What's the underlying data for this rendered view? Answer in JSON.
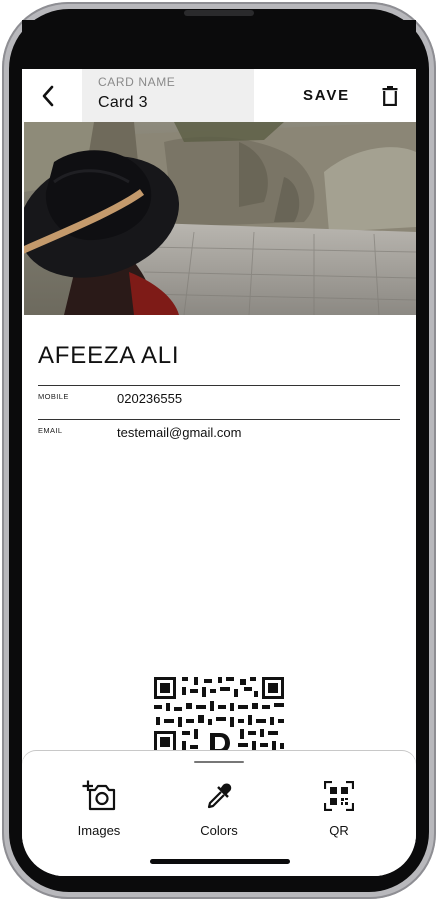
{
  "header": {
    "card_name_label": "CARD NAME",
    "card_name_value": "Card 3",
    "save_label": "SAVE"
  },
  "contact": {
    "name": "AFEEZA ALI",
    "fields": [
      {
        "label": "MOBILE",
        "value": "020236555"
      },
      {
        "label": "EMAIL",
        "value": "testemail@gmail.com"
      }
    ]
  },
  "toolbar": {
    "images_label": "Images",
    "colors_label": "Colors",
    "qr_label": "QR"
  },
  "icons": {
    "back": "chevron-left-icon",
    "delete": "trash-icon",
    "images": "camera-add-icon",
    "colors": "eyedropper-icon",
    "qr": "qr-scan-icon"
  },
  "colors": {
    "screen_bg": "#ffffff",
    "text": "#111111",
    "card_name_field_bg": "#efefef",
    "phone_bezel": "#0b0b0c"
  }
}
